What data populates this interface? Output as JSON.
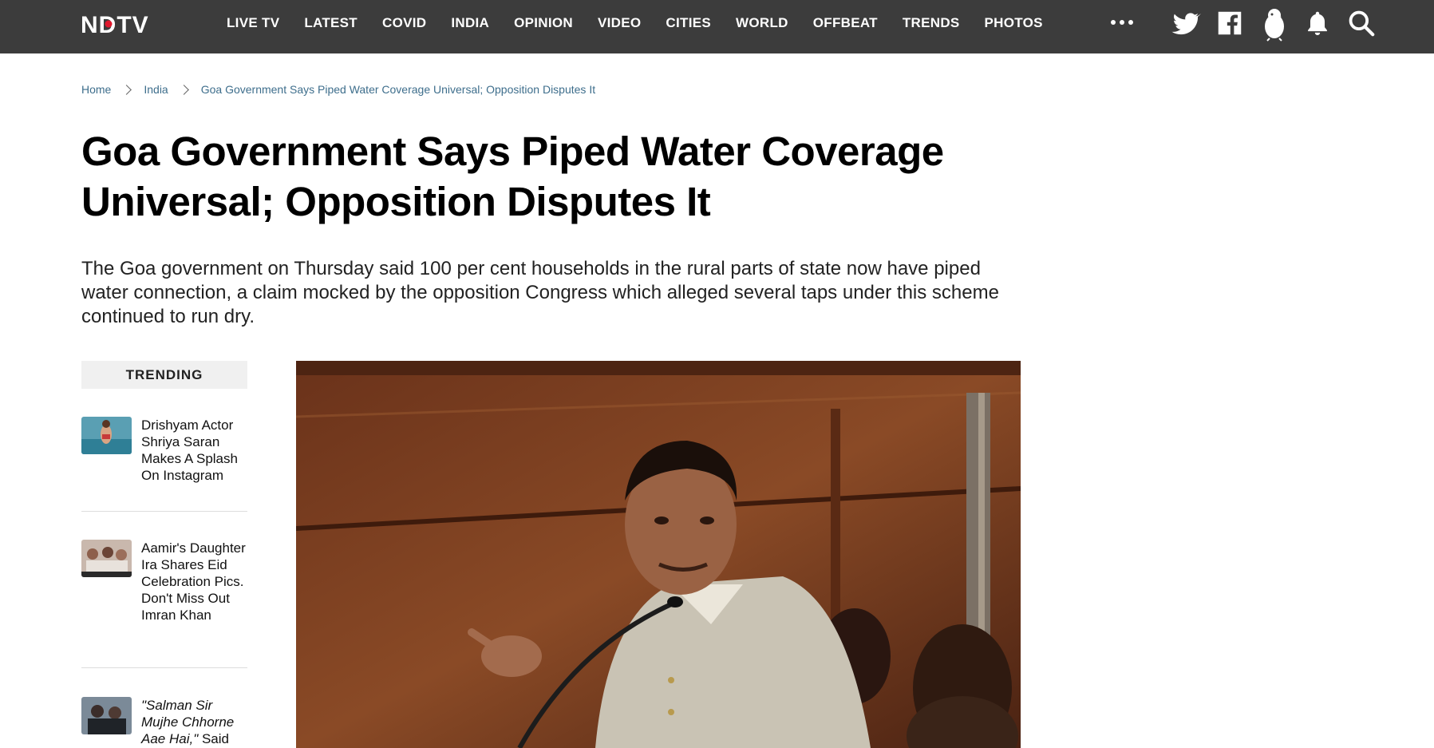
{
  "brand": {
    "logo_text": "NDTV",
    "nav_bg": "#3c3c3c",
    "accent": "#e0182d"
  },
  "nav": {
    "links": [
      "LIVE TV",
      "LATEST",
      "COVID",
      "INDIA",
      "OPINION",
      "VIDEO",
      "CITIES",
      "WORLD",
      "OFFBEAT",
      "TRENDS",
      "PHOTOS"
    ],
    "icons": [
      "more-icon",
      "twitter-icon",
      "facebook-icon",
      "koo-icon",
      "bell-icon",
      "search-icon"
    ]
  },
  "breadcrumb": {
    "home": "Home",
    "section": "India",
    "current": "Goa Government Says Piped Water Coverage Universal; Opposition Disputes It"
  },
  "article": {
    "headline": "Goa Government Says Piped Water Coverage Universal; Opposition Disputes It",
    "summary": "The Goa government on Thursday said 100 per cent households in the rural parts of state now have piped water connection, a claim mocked by the opposition Congress which alleged several taps under this scheme continued to run dry."
  },
  "trending": {
    "heading": "TRENDING",
    "items": [
      {
        "title": "Drishyam Actor Shriya Saran Makes A Splash On Instagram"
      },
      {
        "title": "Aamir's Daughter Ira Shares Eid Celebration Pics. Don't Miss Out Imran Khan"
      },
      {
        "title_quote": "\"Salman Sir Mujhe Chhorne Aae Hai,\"",
        "title_rest": " Said"
      }
    ]
  }
}
